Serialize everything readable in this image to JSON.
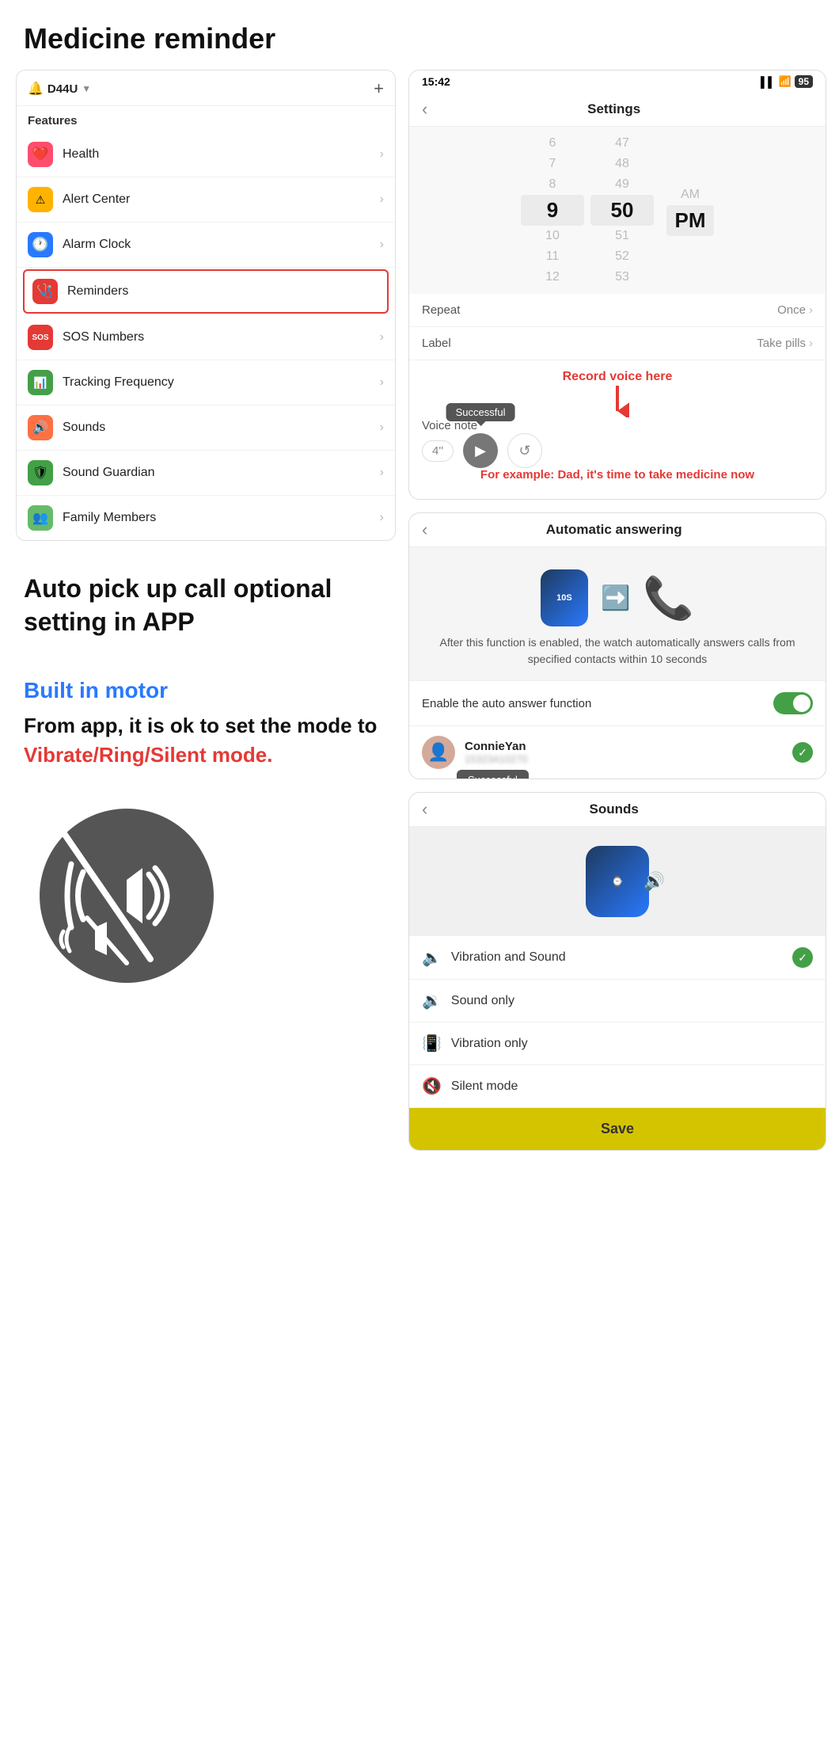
{
  "page": {
    "title": "Medicine reminder"
  },
  "sidebar": {
    "device": "D44U",
    "add_btn": "+",
    "features_label": "Features",
    "items": [
      {
        "id": "health",
        "label": "Health",
        "icon": "❤️",
        "icon_class": "icon-health",
        "active": false
      },
      {
        "id": "alert",
        "label": "Alert Center",
        "icon": "🟠",
        "icon_class": "icon-alert",
        "active": false
      },
      {
        "id": "alarm",
        "label": "Alarm Clock",
        "icon": "🕐",
        "icon_class": "icon-alarm",
        "active": false
      },
      {
        "id": "reminders",
        "label": "Reminders",
        "icon": "🩺",
        "icon_class": "icon-reminder",
        "active": true
      },
      {
        "id": "sos",
        "label": "SOS Numbers",
        "icon": "SOS",
        "icon_class": "icon-sos",
        "active": false
      },
      {
        "id": "tracking",
        "label": "Tracking Frequency",
        "icon": "📊",
        "icon_class": "icon-tracking",
        "active": false
      },
      {
        "id": "sounds",
        "label": "Sounds",
        "icon": "🔊",
        "icon_class": "icon-sounds",
        "active": false
      },
      {
        "id": "soundguardian",
        "label": "Sound Guardian",
        "icon": "🛡️",
        "icon_class": "icon-soundguardian",
        "active": false
      },
      {
        "id": "family",
        "label": "Family Members",
        "icon": "👨‍👩‍👧",
        "icon_class": "icon-family",
        "active": false
      }
    ]
  },
  "settings_screen": {
    "status_time": "15:42",
    "battery": "95",
    "back_icon": "‹",
    "title": "Settings",
    "time_picker": {
      "hours": [
        "6",
        "7",
        "8",
        "9",
        "10",
        "11",
        "12"
      ],
      "selected_hour": "9",
      "minutes": [
        "47",
        "48",
        "49",
        "50",
        "51",
        "52",
        "53"
      ],
      "selected_minute": "50",
      "ampm_options": [
        "AM",
        "PM"
      ],
      "selected_ampm": "PM"
    },
    "repeat_label": "Repeat",
    "repeat_value": "Once",
    "label_label": "Label",
    "label_value": "Take pills",
    "voice_note_label": "Voice note",
    "voice_duration": "4''",
    "successful_tooltip": "Successful",
    "annotation_record": "Record voice here",
    "annotation_example": "For example: Dad, it's time to take medicine now"
  },
  "auto_answer_screen": {
    "back_icon": "‹",
    "title": "Automatic answering",
    "description": "After this function is enabled, the watch automatically answers calls from specified contacts within 10 seconds",
    "toggle_label": "Enable the auto answer function",
    "contact_name": "ConnieYan",
    "contact_phone": "15323410270",
    "successful_tooltip": "Successful"
  },
  "left_annotations": {
    "auto_pickup_title": "Auto pick up call optional setting in APP",
    "motor_title": "Built in motor",
    "motor_desc_1": "From app, it is ok to set the mode to",
    "motor_highlight": "Vibrate/Ring/Silent mode."
  },
  "sounds_screen": {
    "back_icon": "‹",
    "title": "Sounds",
    "options": [
      {
        "id": "vibration_sound",
        "label": "Vibration and Sound",
        "selected": true
      },
      {
        "id": "sound_only",
        "label": "Sound only",
        "selected": false
      },
      {
        "id": "vibration_only",
        "label": "Vibration only",
        "selected": false
      },
      {
        "id": "silent",
        "label": "Silent mode",
        "selected": false
      }
    ],
    "save_label": "Save"
  }
}
